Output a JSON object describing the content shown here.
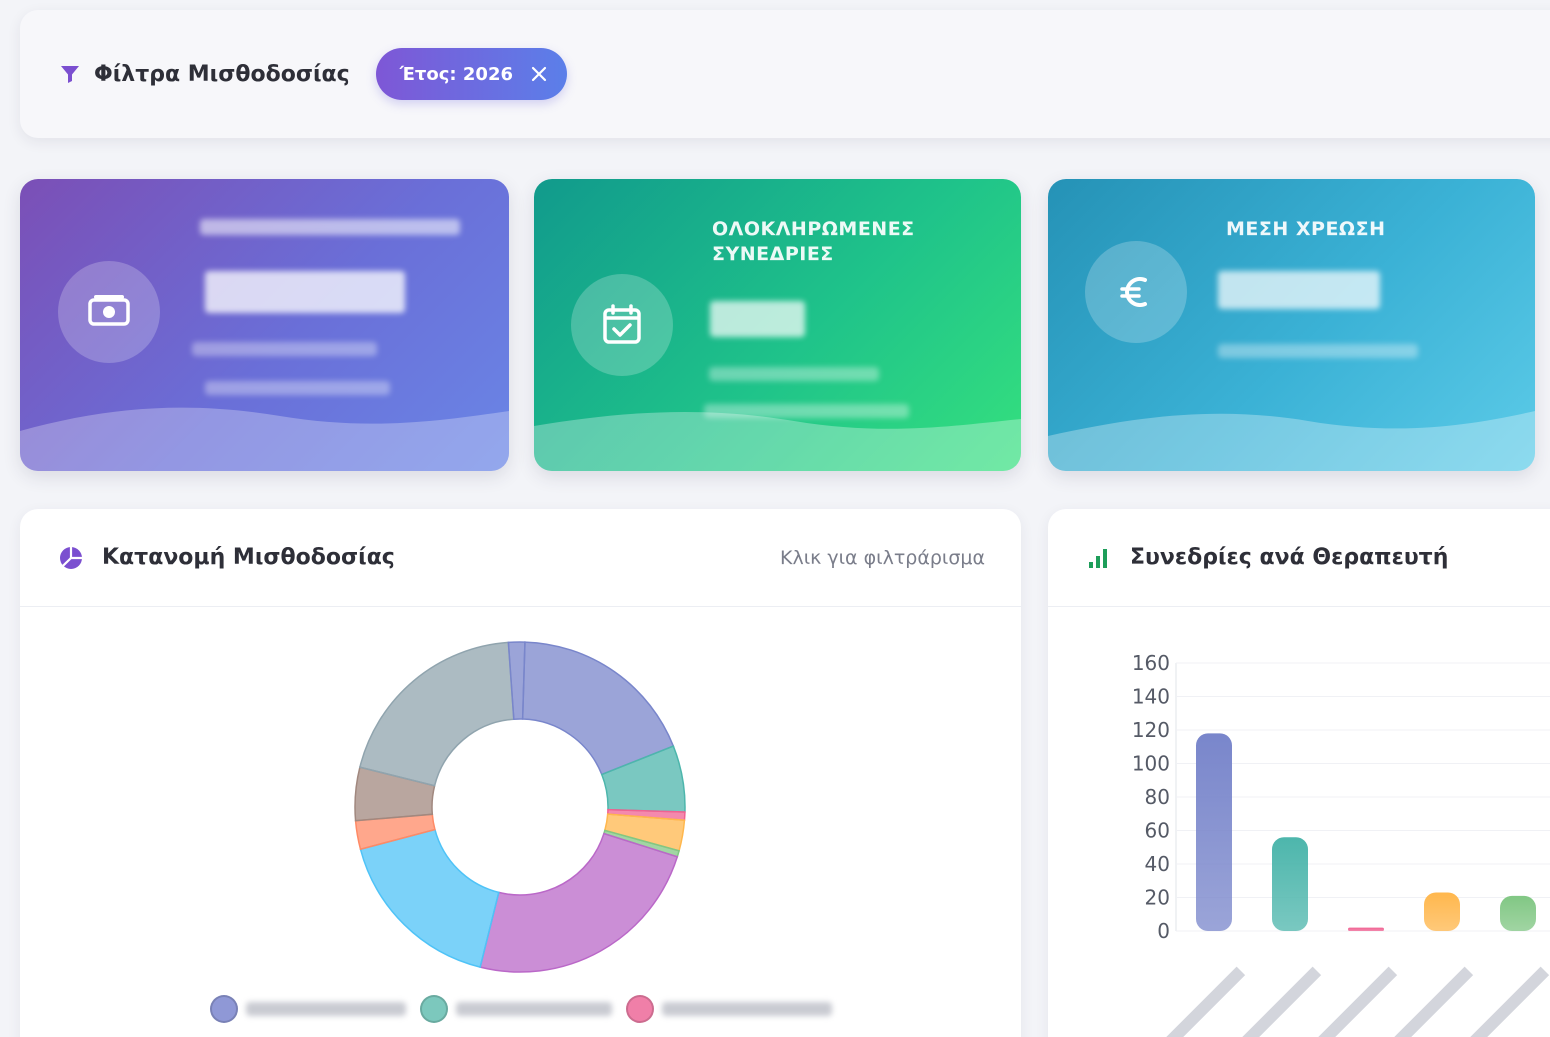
{
  "filters": {
    "title": "Φίλτρα Μισθοδοσίας",
    "chip_label": "Έτος: 2026"
  },
  "cards": [
    {
      "label": "",
      "icon": "money-icon"
    },
    {
      "label": "ΟΛΟΚΛΗΡΩΜΕΝΕΣ ΣΥΝΕΔΡΙΕΣ",
      "icon": "calendar-check-icon"
    },
    {
      "label": "ΜΕΣΗ ΧΡΕΩΣΗ",
      "icon": "euro-icon"
    }
  ],
  "distribution_panel": {
    "title": "Κατανομή Μισθοδοσίας",
    "hint": "Κλικ για φιλτράρισμα",
    "icon": "pie-chart-icon"
  },
  "sessions_panel": {
    "title": "Συνεδρίες ανά Θεραπευτή",
    "icon": "bar-chart-icon"
  },
  "colors": {
    "purple": "#7986cb",
    "teal": "#4db6ac",
    "pink": "#f06292",
    "orange": "#ffb74d",
    "green": "#81c784",
    "sky": "#4fc3f7",
    "violet": "#ba68c8",
    "salmon": "#ff8a65",
    "brown": "#a1887f",
    "grey": "#90a4ae"
  },
  "chart_data": [
    {
      "type": "pie",
      "slices": [
        {
          "value": 18.5,
          "color": "#7986cb"
        },
        {
          "value": 6.5,
          "color": "#4db6ac"
        },
        {
          "value": 0.8,
          "color": "#f06292"
        },
        {
          "value": 3.0,
          "color": "#ffb74d"
        },
        {
          "value": 0.6,
          "color": "#81c784"
        },
        {
          "value": 24.0,
          "color": "#ba68c8"
        },
        {
          "value": 17.0,
          "color": "#4fc3f7"
        },
        {
          "value": 2.8,
          "color": "#ff8a65"
        },
        {
          "value": 5.2,
          "color": "#a1887f"
        },
        {
          "value": 20.0,
          "color": "#90a4ae"
        },
        {
          "value": 1.6,
          "color": "#7986cb"
        }
      ]
    },
    {
      "type": "bar",
      "ylim": [
        0,
        160
      ],
      "yticks": [
        "0",
        "20",
        "40",
        "60",
        "80",
        "100",
        "120",
        "140",
        "160"
      ],
      "values": [
        118,
        56,
        2,
        23,
        21
      ],
      "colors": [
        "#7986cb",
        "#4db6ac",
        "#f06292",
        "#ffb74d",
        "#81c784"
      ]
    }
  ]
}
